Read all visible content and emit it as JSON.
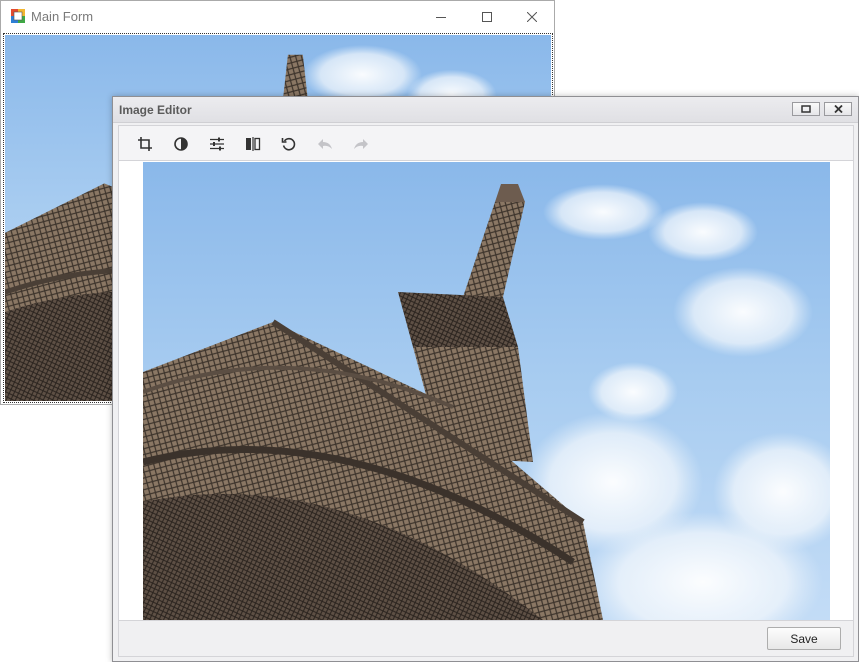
{
  "main_form": {
    "title": "Main Form",
    "icons": {
      "app": "app-form-icon",
      "minimize": "minimize-icon",
      "maximize": "maximize-icon",
      "close": "close-icon"
    }
  },
  "image_editor": {
    "title": "Image Editor",
    "icons": {
      "restore": "restore-icon",
      "close": "close-icon"
    },
    "toolbar": [
      {
        "name": "crop",
        "icon": "crop-icon",
        "enabled": true
      },
      {
        "name": "brightness-contrast",
        "icon": "contrast-icon",
        "enabled": true
      },
      {
        "name": "adjustments",
        "icon": "sliders-icon",
        "enabled": true
      },
      {
        "name": "flip",
        "icon": "flip-icon",
        "enabled": true
      },
      {
        "name": "rotate",
        "icon": "rotate-icon",
        "enabled": true
      },
      {
        "name": "undo",
        "icon": "undo-icon",
        "enabled": false
      },
      {
        "name": "redo",
        "icon": "redo-icon",
        "enabled": false
      }
    ],
    "save_label": "Save"
  },
  "colors": {
    "sky": "#a6cbf0",
    "tower": "#7d6a58",
    "accent_disabled": "#c4c4c8"
  }
}
